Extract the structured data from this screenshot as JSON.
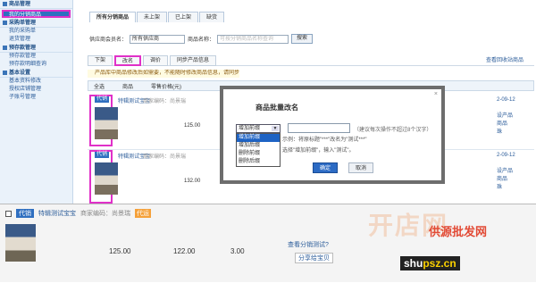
{
  "sidebar": {
    "sections": [
      {
        "title": "商品管理",
        "items": [
          {
            "label": "我的分销商品",
            "active": true
          }
        ]
      },
      {
        "title": "采购单管理",
        "items": [
          {
            "label": "我的采购单",
            "active": false
          },
          {
            "label": "退货管理",
            "active": false
          }
        ]
      },
      {
        "title": "预存款管理",
        "items": [
          {
            "label": "预存款管理",
            "active": false
          },
          {
            "label": "预存款明细查询",
            "active": false
          }
        ]
      },
      {
        "title": "基本设置",
        "items": [
          {
            "label": "基本资料修改",
            "active": false
          },
          {
            "label": "授权店铺管理",
            "active": false
          },
          {
            "label": "子账号管理",
            "active": false
          }
        ]
      }
    ]
  },
  "tabs": [
    "所有分销商品",
    "未上架",
    "已上架",
    "缺货"
  ],
  "filter": {
    "supplier_label": "供应商会员名：",
    "supplier_value": "所有供应商",
    "name_label": "商品名称：",
    "name_placeholder": "可按分销商品名称查询",
    "search": "搜索"
  },
  "actions": [
    "下架",
    "改名",
    "调价",
    "同步产品信息"
  ],
  "recycle": "查看回收站商品",
  "notice": "产品库中商品修改后如需要，不能随时修改商品信息，请同步产品信息",
  "table": {
    "headers": [
      "全选",
      "商品",
      "零售价格(元)"
    ]
  },
  "rows": [
    {
      "tag": "代销",
      "name": "特辑测试宝宝",
      "dim": "商家编码：尚景瑞",
      "price": "125.00",
      "side": [
        "2-09-12",
        "设产品",
        "商品",
        "珠"
      ]
    },
    {
      "tag": "代销",
      "name": "特辑测试宝宝",
      "dim": "商家编码：尚景瑞",
      "price": "132.00",
      "side": [
        "2-09-12",
        "设产品",
        "商品",
        "珠"
      ]
    }
  ],
  "dialog": {
    "title": "商品批量改名",
    "close": "×",
    "select_value": "增加前缀",
    "options": [
      "增加前缀",
      "增加后缀",
      "删除前缀",
      "删除后缀"
    ],
    "hint": "（建议每次操作不超过8个汉字）",
    "example1": "示例：将原标题\"***\"改名为\"测试***\"",
    "example2": "选择\"增加前缀\"，输入\"测试\"。",
    "ok": "确定",
    "cancel": "取消"
  },
  "bottom": {
    "tag": "代销",
    "name": "特辑测试宝宝",
    "dim": "商家编码：尚景瑞",
    "badge": "代运",
    "values": [
      "125.00",
      "122.00",
      "3.00"
    ],
    "link": "查看分销测试?",
    "share": "分享给宝贝"
  },
  "watermark": {
    "cn": "开店网",
    "logo": "供源批发网",
    "url_main": "shu",
    "url_accent": "psz.cn"
  }
}
